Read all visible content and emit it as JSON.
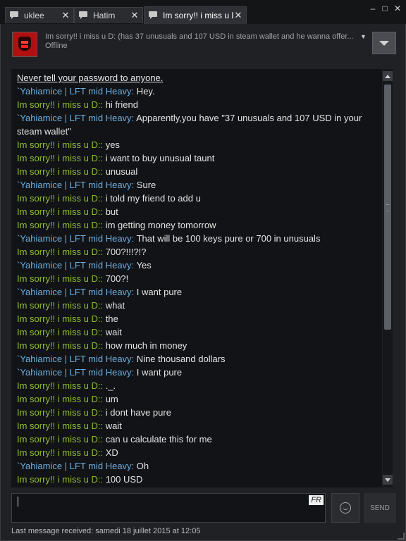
{
  "tabs": [
    {
      "label": "uklee",
      "active": false
    },
    {
      "label": "Hatim",
      "active": false
    },
    {
      "label": "Im sorry!! i miss u D:",
      "active": true
    }
  ],
  "window_controls": {
    "minimize": "–",
    "maximize": "□",
    "close": "✕"
  },
  "header": {
    "name_line": "Im sorry!! i miss u D: (has 37 unusuals and 107 USD in steam wallet and he wanna offer...",
    "status": "Offline"
  },
  "warning": "Never tell your password to anyone.",
  "messages": [
    {
      "sender": "`Yahiamice | LFT mid Heavy",
      "color": "blue",
      "text": " Hey."
    },
    {
      "sender": "Im sorry!! i miss u D:",
      "color": "green",
      "text": " hi friend"
    },
    {
      "sender": "`Yahiamice | LFT mid Heavy",
      "color": "blue",
      "text": " Apparently,you have \"37 unusuals and 107 USD in your steam wallet\""
    },
    {
      "sender": "Im sorry!! i miss u D:",
      "color": "green",
      "text": " yes"
    },
    {
      "sender": "Im sorry!! i miss u D:",
      "color": "green",
      "text": " i want to buy unusual taunt"
    },
    {
      "sender": "Im sorry!! i miss u D:",
      "color": "green",
      "text": " unusual"
    },
    {
      "sender": "`Yahiamice | LFT mid Heavy",
      "color": "blue",
      "text": " Sure"
    },
    {
      "sender": "Im sorry!! i miss u D:",
      "color": "green",
      "text": " i told my friend to add u"
    },
    {
      "sender": "Im sorry!! i miss u D:",
      "color": "green",
      "text": " but"
    },
    {
      "sender": "Im sorry!! i miss u D:",
      "color": "green",
      "text": " im getting money tomorrow"
    },
    {
      "sender": "`Yahiamice | LFT mid Heavy",
      "color": "blue",
      "text": " That will be 100 keys pure or 700 in unusuals"
    },
    {
      "sender": "Im sorry!! i miss u D:",
      "color": "green",
      "text": " 700?!!!?!?"
    },
    {
      "sender": "`Yahiamice | LFT mid Heavy",
      "color": "blue",
      "text": " Yes"
    },
    {
      "sender": "Im sorry!! i miss u D:",
      "color": "green",
      "text": " 700?!"
    },
    {
      "sender": "`Yahiamice | LFT mid Heavy",
      "color": "blue",
      "text": " I want pure"
    },
    {
      "sender": "Im sorry!! i miss u D:",
      "color": "green",
      "text": " what"
    },
    {
      "sender": "Im sorry!! i miss u D:",
      "color": "green",
      "text": " the"
    },
    {
      "sender": "Im sorry!! i miss u D:",
      "color": "green",
      "text": " wait"
    },
    {
      "sender": "Im sorry!! i miss u D:",
      "color": "green",
      "text": " how much in money"
    },
    {
      "sender": "`Yahiamice | LFT mid Heavy",
      "color": "blue",
      "text": " Nine thousand dollars"
    },
    {
      "sender": "`Yahiamice | LFT mid Heavy",
      "color": "blue",
      "text": " I want pure"
    },
    {
      "sender": "Im sorry!! i miss u D:",
      "color": "green",
      "text": " ._."
    },
    {
      "sender": "Im sorry!! i miss u D:",
      "color": "green",
      "text": " um"
    },
    {
      "sender": "Im sorry!! i miss u D:",
      "color": "green",
      "text": " i dont have pure"
    },
    {
      "sender": "Im sorry!! i miss u D:",
      "color": "green",
      "text": " wait"
    },
    {
      "sender": "Im sorry!! i miss u D:",
      "color": "green",
      "text": " can u calculate this for me"
    },
    {
      "sender": "Im sorry!! i miss u D:",
      "color": "green",
      "text": " XD"
    },
    {
      "sender": "`Yahiamice | LFT mid Heavy",
      "color": "blue",
      "text": " Oh"
    },
    {
      "sender": "Im sorry!! i miss u D:",
      "color": "green",
      "text": " 100 USD"
    }
  ],
  "input": {
    "value": "",
    "lang_badge": "FR"
  },
  "send_label": "SEND",
  "footer": "Last message received: samedi 18 juillet 2015 at 12:05",
  "colors": {
    "green_name": "#8fbf2f",
    "blue_name": "#6db0e0",
    "background": "#121316"
  }
}
